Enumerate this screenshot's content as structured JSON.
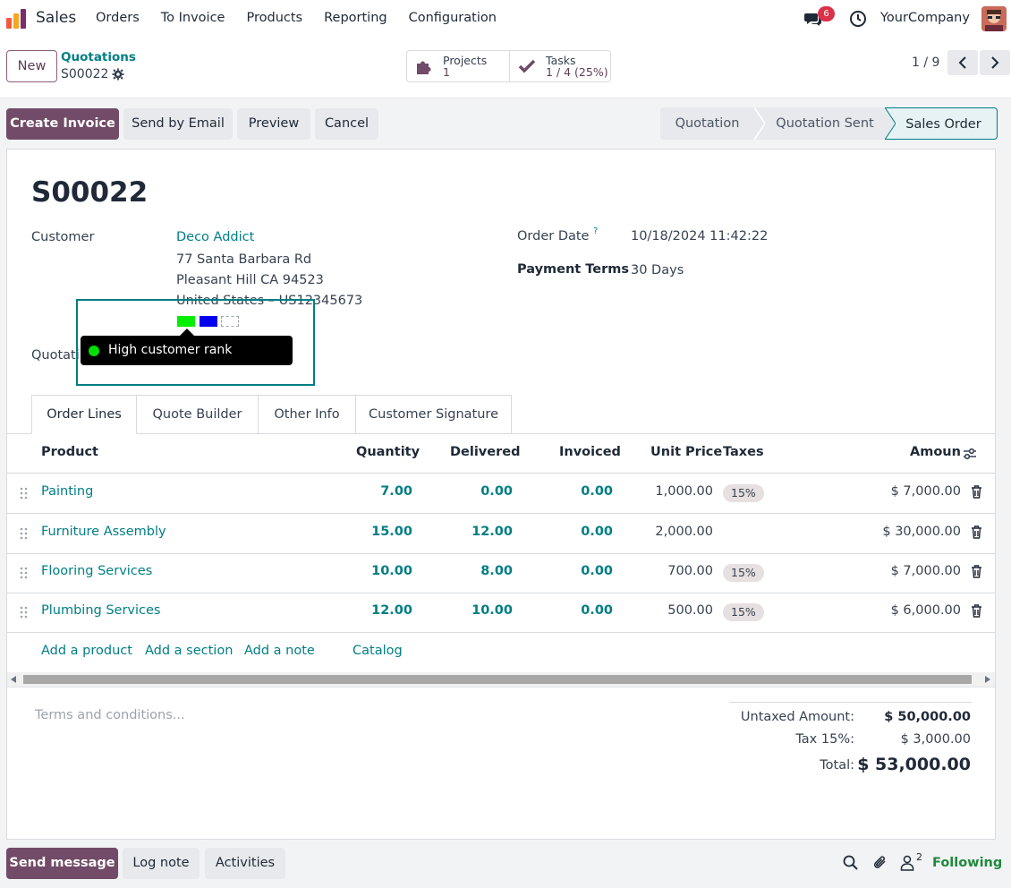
{
  "nav": {
    "app_name": "Sales",
    "menu": [
      "Orders",
      "To Invoice",
      "Products",
      "Reporting",
      "Configuration"
    ],
    "notification_count": "6",
    "company": "YourCompany"
  },
  "control": {
    "new_label": "New",
    "breadcrumb": "Quotations",
    "record": "S00022",
    "projects_label": "Projects",
    "projects_value": "1",
    "tasks_label": "Tasks",
    "tasks_value": "1 / 4 (25%)",
    "pager": "1 / 9"
  },
  "actions": {
    "create_invoice": "Create Invoice",
    "send_email": "Send by Email",
    "preview": "Preview",
    "cancel": "Cancel",
    "stages": [
      "Quotation",
      "Quotation Sent",
      "Sales Order"
    ],
    "active_stage": "Sales Order"
  },
  "form": {
    "title": "S00022",
    "customer_label": "Customer",
    "customer_name": "Deco Addict",
    "address1": "77 Santa Barbara Rd",
    "address2": "Pleasant Hill CA 94523",
    "address3": "United States – US12345673",
    "quotation_label_partial": "Quotati",
    "order_date_label": "Order Date",
    "order_date_help": "?",
    "order_date": "10/18/2024 11:42:22",
    "payment_terms_label": "Payment Terms",
    "payment_terms": "30 Days",
    "color_chips": [
      "#00ee00",
      "#0000ee",
      "none"
    ],
    "tooltip_text": "High customer rank",
    "tooltip_dot_color": "#00e000"
  },
  "tabs": [
    "Order Lines",
    "Quote Builder",
    "Other Info",
    "Customer Signature"
  ],
  "table": {
    "headers": {
      "product": "Product",
      "quantity": "Quantity",
      "delivered": "Delivered",
      "invoiced": "Invoiced",
      "unit_price": "Unit Price",
      "taxes": "Taxes",
      "amount": "Amoun"
    },
    "rows": [
      {
        "product": "Painting",
        "quantity": "7.00",
        "delivered": "0.00",
        "invoiced": "0.00",
        "unit_price": "1,000.00",
        "tax": "15%",
        "amount": "$ 7,000.00"
      },
      {
        "product": "Furniture Assembly",
        "quantity": "15.00",
        "delivered": "12.00",
        "invoiced": "0.00",
        "unit_price": "2,000.00",
        "tax": "",
        "amount": "$ 30,000.00"
      },
      {
        "product": "Flooring Services",
        "quantity": "10.00",
        "delivered": "8.00",
        "invoiced": "0.00",
        "unit_price": "700.00",
        "tax": "15%",
        "amount": "$ 7,000.00"
      },
      {
        "product": "Plumbing Services",
        "quantity": "12.00",
        "delivered": "10.00",
        "invoiced": "0.00",
        "unit_price": "500.00",
        "tax": "15%",
        "amount": "$ 6,000.00"
      }
    ],
    "add_links": [
      "Add a product",
      "Add a section",
      "Add a note",
      "Catalog"
    ]
  },
  "footer": {
    "terms_placeholder": "Terms and conditions...",
    "untaxed_label": "Untaxed Amount:",
    "untaxed_value": "$ 50,000.00",
    "tax_label": "Tax 15%:",
    "tax_value": "$ 3,000.00",
    "total_label": "Total:",
    "total_value": "$ 53,000.00"
  },
  "chatter": {
    "send_message": "Send message",
    "log_note": "Log note",
    "activities": "Activities",
    "followers_count": "2",
    "following": "Following"
  },
  "colors": {
    "brand": "#714b67",
    "link": "#017e84",
    "following": "#1e8a3a"
  }
}
